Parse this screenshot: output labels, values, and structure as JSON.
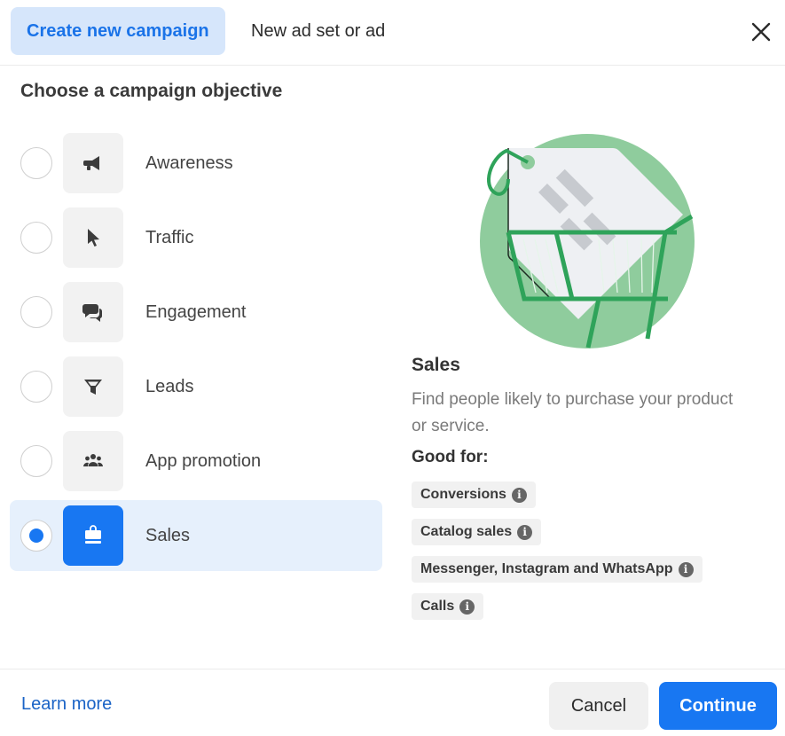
{
  "header": {
    "tabs": [
      {
        "label": "Create new campaign",
        "active": true
      },
      {
        "label": "New ad set or ad",
        "active": false
      }
    ],
    "close_icon": "close-icon"
  },
  "main": {
    "section_title": "Choose a campaign objective",
    "objectives": [
      {
        "label": "Awareness",
        "icon": "megaphone-icon",
        "selected": false
      },
      {
        "label": "Traffic",
        "icon": "cursor-icon",
        "selected": false
      },
      {
        "label": "Engagement",
        "icon": "chat-bubbles-icon",
        "selected": false
      },
      {
        "label": "Leads",
        "icon": "funnel-icon",
        "selected": false
      },
      {
        "label": "App promotion",
        "icon": "people-group-icon",
        "selected": false
      },
      {
        "label": "Sales",
        "icon": "shopping-bag-icon",
        "selected": true
      }
    ],
    "detail": {
      "illustration": "shopping-cart-price-tag-illustration",
      "title": "Sales",
      "description": "Find people likely to purchase your product or service.",
      "good_for_label": "Good for:",
      "good_for": [
        {
          "label": "Conversions",
          "icon": "info-icon"
        },
        {
          "label": "Catalog sales",
          "icon": "info-icon"
        },
        {
          "label": "Messenger, Instagram and WhatsApp",
          "icon": "info-icon"
        },
        {
          "label": "Calls",
          "icon": "info-icon"
        }
      ]
    }
  },
  "footer": {
    "learn_more": "Learn more",
    "cancel": "Cancel",
    "continue": "Continue"
  },
  "colors": {
    "accent": "#1877f2",
    "tab_active_bg": "#d6e6fb",
    "selected_row_bg": "#e6f0fc",
    "illustration_green": "#8fcc9d",
    "illustration_dark_green": "#2fa35a"
  }
}
